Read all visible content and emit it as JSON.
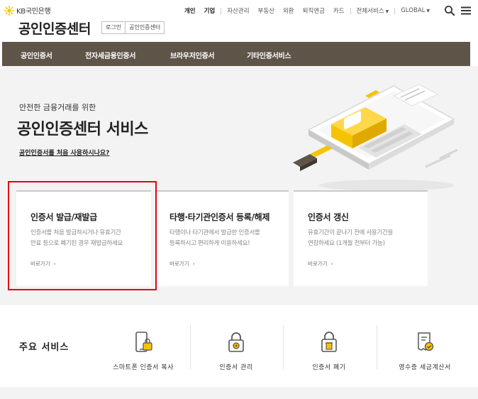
{
  "header": {
    "logo_text": "KB국민은행",
    "site_title": "공인인증센터",
    "util_buttons": [
      "로그인",
      "공인인증센터"
    ],
    "topnav": {
      "primary": [
        "개인",
        "기업"
      ],
      "secondary": [
        "자산관리",
        "부동산",
        "외환",
        "퇴직연금",
        "카드"
      ],
      "all_services": "전체서비스",
      "language": "GLOBAL"
    }
  },
  "gnb": {
    "items": [
      "공인인증서",
      "전자세금용인증서",
      "브라우저인증서",
      "기타인증서비스"
    ]
  },
  "hero": {
    "subtitle": "안전한 금융거래를 위한",
    "title": "공인인증센터 서비스",
    "link": "공인인증서를 처음 사용하시나요?"
  },
  "cards": [
    {
      "title": "인증서 발급/재발급",
      "desc_lines": [
        "인증서를 처음 발급하시거나 유효기간",
        "만료 등으로 폐기된 경우 재발급하세요"
      ],
      "link": "바로가기",
      "arrow": "›"
    },
    {
      "title": "타행·타기관인증서 등록/해제",
      "desc_lines": [
        "타행이나 타기관에서 발급한 인증서를",
        "등록하시고 편리하게 이용하세요!"
      ],
      "link": "바로가기",
      "arrow": "›"
    },
    {
      "title": "인증서 갱신",
      "desc_lines": [
        "유효기간이 끝나기 전에 사용기간을",
        "연장하세요 (1개월 전부터 가능)"
      ],
      "link": "바로가기",
      "arrow": "›"
    }
  ],
  "services": {
    "heading": "주요 서비스",
    "items": [
      {
        "label": "스마트폰 인증서 복사",
        "icon": "smartphone-lock-icon"
      },
      {
        "label": "인증서 관리",
        "icon": "lock-gear-icon"
      },
      {
        "label": "인증서 폐기",
        "icon": "lock-trash-icon"
      },
      {
        "label": "영수증 세금계산서",
        "icon": "receipt-check-icon"
      }
    ]
  },
  "colors": {
    "gnb_bg": "#5e5448",
    "accent_yellow": "#f5c400",
    "highlight_red": "#e60012",
    "hero_bg": "#f3f3f3"
  }
}
